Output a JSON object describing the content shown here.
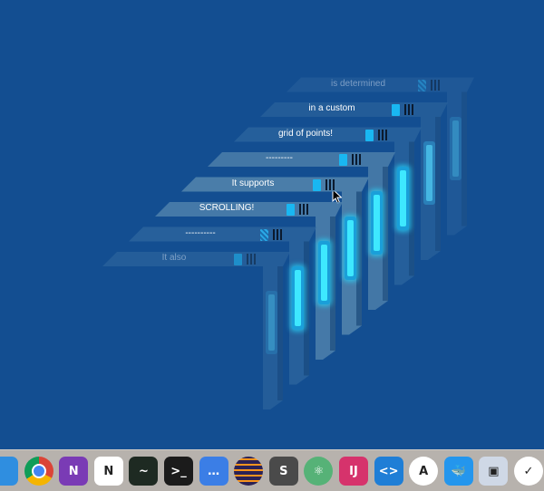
{
  "labels": [
    "is determined",
    "in a custom",
    "grid of points!",
    "---------",
    "It supports",
    "SCROLLING!",
    "----------",
    "It also"
  ],
  "dock_icons": [
    {
      "name": "finder-icon",
      "glyph": "",
      "color": "#2f8ee0"
    },
    {
      "name": "chrome-icon",
      "glyph": "",
      "color": "#ffffff"
    },
    {
      "name": "onenote-icon",
      "glyph": "N",
      "color": "#7a3bb5"
    },
    {
      "name": "notion-icon",
      "glyph": "N",
      "color": "#ffffff"
    },
    {
      "name": "activity-monitor-icon",
      "glyph": "~",
      "color": "#1e2a22"
    },
    {
      "name": "terminal-icon",
      "glyph": ">_",
      "color": "#1b1b1b"
    },
    {
      "name": "messages-app-icon",
      "glyph": "…",
      "color": "#3b7ee6"
    },
    {
      "name": "eclipse-icon",
      "glyph": "",
      "color": "#2c2255"
    },
    {
      "name": "sublime-text-icon",
      "glyph": "S",
      "color": "#4a4a4a"
    },
    {
      "name": "atom-icon",
      "glyph": "⚛",
      "color": "#56b277"
    },
    {
      "name": "intellij-icon",
      "glyph": "IJ",
      "color": "#d6336c"
    },
    {
      "name": "vscode-icon",
      "glyph": "<>",
      "color": "#1f7ed6"
    },
    {
      "name": "xcode-instruments-icon",
      "glyph": "A",
      "color": "#ffffff"
    },
    {
      "name": "docker-icon",
      "glyph": "🐳",
      "color": "#2496ed"
    },
    {
      "name": "virtualbox-icon",
      "glyph": "▣",
      "color": "#cfd8e6"
    },
    {
      "name": "tasks-icon",
      "glyph": "✓",
      "color": "#ffffff"
    }
  ]
}
